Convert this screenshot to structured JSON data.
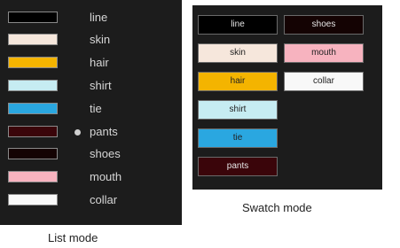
{
  "list_mode": {
    "caption": "List mode",
    "items": [
      {
        "label": "line",
        "color": "#000000"
      },
      {
        "label": "skin",
        "color": "#f6e7dc"
      },
      {
        "label": "hair",
        "color": "#f4b400"
      },
      {
        "label": "shirt",
        "color": "#c6ecf2"
      },
      {
        "label": "tie",
        "color": "#2aa7e0"
      },
      {
        "label": "pants",
        "color": "#3a050a",
        "selected": true
      },
      {
        "label": "shoes",
        "color": "#140303"
      },
      {
        "label": "mouth",
        "color": "#f7b3bf"
      },
      {
        "label": "collar",
        "color": "#f8f8f8"
      }
    ]
  },
  "swatch_mode": {
    "caption": "Swatch mode",
    "items": [
      {
        "label": "line",
        "color": "#000000",
        "text_color": "#e6e6e6"
      },
      {
        "label": "shoes",
        "color": "#140303",
        "text_color": "#e6e6e6"
      },
      {
        "label": "skin",
        "color": "#f6e7dc",
        "text_color": "#222222"
      },
      {
        "label": "mouth",
        "color": "#f7b3bf",
        "text_color": "#222222"
      },
      {
        "label": "hair",
        "color": "#f4b400",
        "text_color": "#222222"
      },
      {
        "label": "collar",
        "color": "#f8f8f8",
        "text_color": "#222222"
      },
      {
        "label": "shirt",
        "color": "#c6ecf2",
        "text_color": "#222222"
      },
      {
        "label": "tie",
        "color": "#2aa7e0",
        "text_color": "#222222"
      },
      {
        "label": "pants",
        "color": "#3a050a",
        "text_color": "#e6e6e6"
      }
    ]
  }
}
